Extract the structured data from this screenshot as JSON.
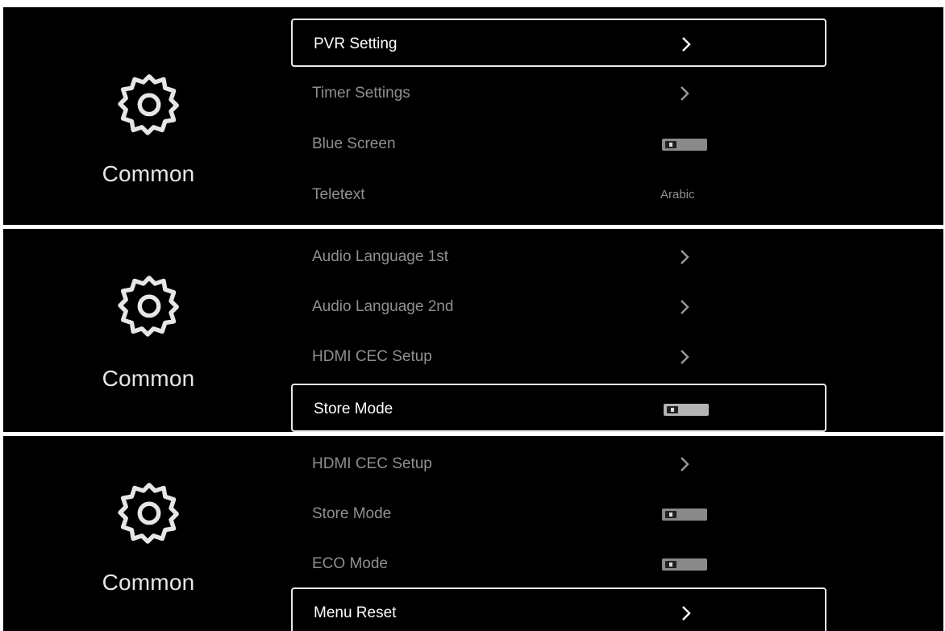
{
  "screens": [
    {
      "category": {
        "icon": "gear-icon",
        "label": "Common"
      },
      "items": [
        {
          "label": "PVR Setting",
          "control": "chevron",
          "focused": true
        },
        {
          "label": "Timer Settings",
          "control": "chevron",
          "focused": false
        },
        {
          "label": "Blue Screen",
          "control": "toggle",
          "state": "off",
          "focused": false
        },
        {
          "label": "Teletext",
          "control": "value",
          "value": "Arabic",
          "focused": false
        }
      ]
    },
    {
      "category": {
        "icon": "gear-icon",
        "label": "Common"
      },
      "items": [
        {
          "label": "Audio Language 1st",
          "control": "chevron",
          "focused": false
        },
        {
          "label": "Audio Language 2nd",
          "control": "chevron",
          "focused": false
        },
        {
          "label": "HDMI CEC Setup",
          "control": "chevron",
          "focused": false
        },
        {
          "label": "Store Mode",
          "control": "toggle",
          "state": "off",
          "focused": true
        }
      ]
    },
    {
      "category": {
        "icon": "gear-icon",
        "label": "Common"
      },
      "items": [
        {
          "label": "HDMI CEC Setup",
          "control": "chevron",
          "focused": false
        },
        {
          "label": "Store Mode",
          "control": "toggle",
          "state": "off",
          "focused": false
        },
        {
          "label": "ECO Mode",
          "control": "toggle",
          "state": "off",
          "focused": false
        },
        {
          "label": "Menu Reset",
          "control": "chevron",
          "focused": true
        }
      ]
    }
  ],
  "colors": {
    "background": "#000000",
    "text_focused": "#ffffff",
    "text_normal": "#8f8f8f",
    "focus_border": "#e8e8e8"
  }
}
